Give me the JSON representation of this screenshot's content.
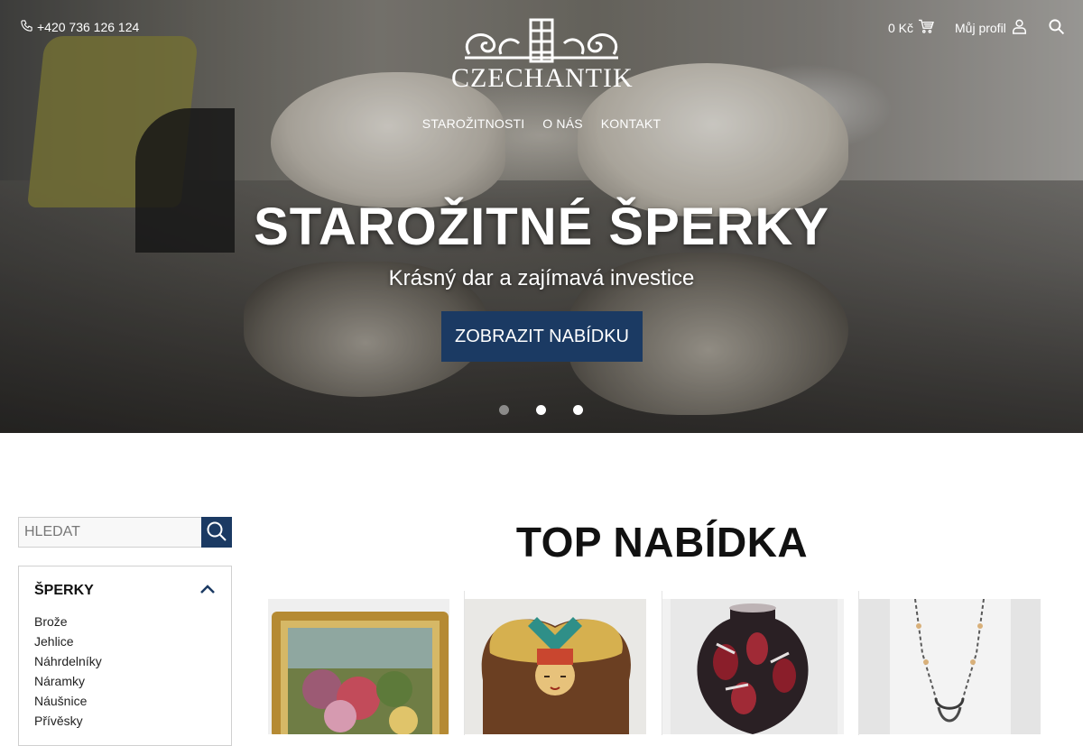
{
  "header": {
    "phone": "+420 736 126 124",
    "logo_text": "CZECHANTIK",
    "cart_amount": "0 Kč",
    "profile_label": "Můj profil"
  },
  "nav": {
    "items": [
      "STAROŽITNOSTI",
      "O NÁS",
      "KONTAKT"
    ]
  },
  "hero": {
    "title": "STAROŽITNÉ ŠPERKY",
    "subtitle": "Krásný dar a zajímavá investice",
    "button_label": "ZOBRAZIT NABÍDKU",
    "slides": 3,
    "active_slide": 1
  },
  "sidebar": {
    "search_placeholder": "HLEDAT",
    "category_title": "ŠPERKY",
    "items": [
      "Brože",
      "Jehlice",
      "Náhrdelníky",
      "Náramky",
      "Náušnice",
      "Přívěsky"
    ]
  },
  "main": {
    "section_title": "TOP NABÍDKA",
    "products": [
      {
        "image": "framed-painting"
      },
      {
        "image": "art-deco-box"
      },
      {
        "image": "glass-vase"
      },
      {
        "image": "necklace"
      }
    ]
  },
  "colors": {
    "accent": "#1b3a63",
    "text": "#222222",
    "border": "#d0d0d0"
  }
}
